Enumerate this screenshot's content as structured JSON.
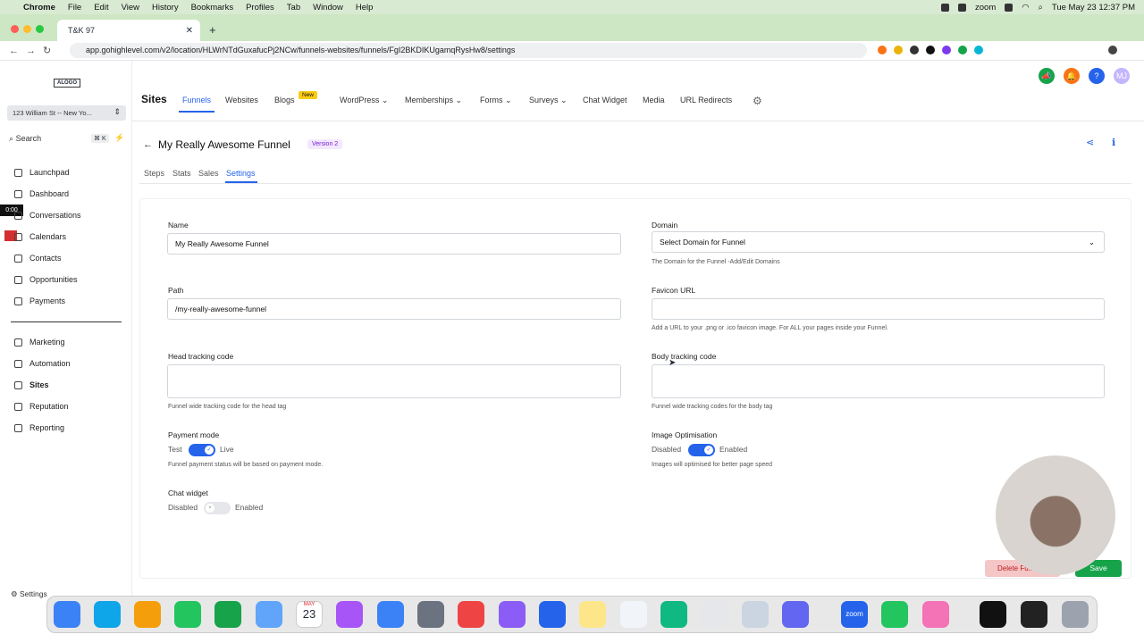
{
  "menubar": {
    "app": "Chrome",
    "items": [
      "File",
      "Edit",
      "View",
      "History",
      "Bookmarks",
      "Profiles",
      "Tab",
      "Window",
      "Help"
    ],
    "zoom": "zoom",
    "datetime": "Tue May 23  12:37 PM"
  },
  "browser": {
    "tab_title": "T&K 97",
    "url": "app.gohighlevel.com/v2/location/HLWrNTdGuxafucPj2NCw/funnels-websites/funnels/FgI2BKDIKUgamqRysHw8/settings"
  },
  "sidebar": {
    "logo": "ALOGO",
    "location": "123 William St -- New Yo...",
    "search_label": "Search",
    "search_shortcut": "⌘ K",
    "timer": "0:00",
    "items": [
      {
        "label": "Launchpad"
      },
      {
        "label": "Dashboard"
      },
      {
        "label": "Conversations"
      },
      {
        "label": "Calendars"
      },
      {
        "label": "Contacts"
      },
      {
        "label": "Opportunities"
      },
      {
        "label": "Payments"
      },
      {
        "label": "Marketing"
      },
      {
        "label": "Automation"
      },
      {
        "label": "Sites"
      },
      {
        "label": "Reputation"
      },
      {
        "label": "Reporting"
      }
    ],
    "settings_label": "Settings"
  },
  "topnav": {
    "title": "Sites",
    "items": [
      "Funnels",
      "Websites",
      "Blogs",
      "WordPress",
      "Memberships",
      "Forms",
      "Surveys",
      "Chat Widget",
      "Media",
      "URL Redirects"
    ],
    "new_badge": "New",
    "avatar_initials": "MJ"
  },
  "funnel": {
    "title": "My Really Awesome Funnel",
    "version": "Version 2",
    "tabs": [
      "Steps",
      "Stats",
      "Sales",
      "Settings"
    ]
  },
  "form": {
    "name_label": "Name",
    "name_value": "My Really Awesome Funnel",
    "domain_label": "Domain",
    "domain_value": "Select Domain for Funnel",
    "domain_help": "The Domain for the Funnel -Add/Edit Domains",
    "path_label": "Path",
    "path_value": "/my-really-awesome-funnel",
    "favicon_label": "Favicon URL",
    "favicon_help": "Add a URL to your .png or .ico favicon image. For ALL your pages inside your Funnel.",
    "head_label": "Head tracking code",
    "head_help": "Funnel wide tracking code for the head tag",
    "body_label": "Body tracking code",
    "body_help": "Funnel wide tracking codes for the body tag",
    "payment_label": "Payment mode",
    "payment_off": "Test",
    "payment_on": "Live",
    "payment_help": "Funnel payment status will be based on payment mode.",
    "imgopt_label": "Image Optimisation",
    "imgopt_off": "Disabled",
    "imgopt_on": "Enabled",
    "imgopt_help": "Images will optimised for better page speed",
    "chat_label": "Chat widget",
    "chat_off": "Disabled",
    "chat_on": "Enabled",
    "delete_label": "Delete Fu...",
    "save_label": "Save"
  },
  "dock": {
    "calendar_month": "MAY",
    "calendar_day": "23",
    "zoom": "zoom"
  },
  "colors": {
    "accent": "#2563eb",
    "save": "#16a34a",
    "chrome_tab": "#cde6c3"
  }
}
